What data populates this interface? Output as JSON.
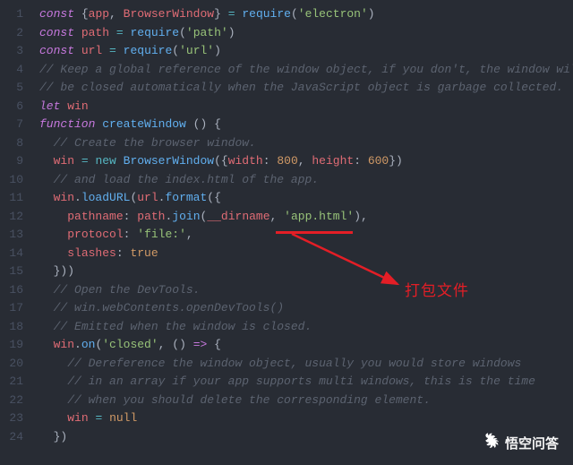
{
  "lines": [
    {
      "n": 1,
      "html": "<span class='kw'>const</span> <span class='pun'>{</span><span class='var'>app</span><span class='pun'>,</span> <span class='var'>BrowserWindow</span><span class='pun'>}</span> <span class='op'>=</span> <span class='fn'>require</span><span class='pun'>(</span><span class='str'>'electron'</span><span class='pun'>)</span>"
    },
    {
      "n": 2,
      "html": "<span class='kw'>const</span> <span class='var'>path</span> <span class='op'>=</span> <span class='fn'>require</span><span class='pun'>(</span><span class='str'>'path'</span><span class='pun'>)</span>"
    },
    {
      "n": 3,
      "html": "<span class='kw'>const</span> <span class='var'>url</span> <span class='op'>=</span> <span class='fn'>require</span><span class='pun'>(</span><span class='str'>'url'</span><span class='pun'>)</span>"
    },
    {
      "n": 4,
      "html": "<span class='com'>// Keep a global reference of the window object, if you don't, the window will</span>"
    },
    {
      "n": 5,
      "html": "<span class='com'>// be closed automatically when the JavaScript object is garbage collected.</span>"
    },
    {
      "n": 6,
      "html": "<span class='kw'>let</span> <span class='var'>win</span>"
    },
    {
      "n": 7,
      "html": "<span class='kw'>function</span> <span class='fn'>createWindow</span> <span class='pun'>() {</span>"
    },
    {
      "n": 8,
      "html": "  <span class='com'>// Create the browser window.</span>"
    },
    {
      "n": 9,
      "html": "  <span class='var'>win</span> <span class='op'>=</span> <span class='op'>new</span> <span class='fn'>BrowserWindow</span><span class='pun'>({</span><span class='var'>width</span><span class='pun'>:</span> <span class='num'>800</span><span class='pun'>,</span> <span class='var'>height</span><span class='pun'>:</span> <span class='num'>600</span><span class='pun'>})</span>"
    },
    {
      "n": 10,
      "html": "  <span class='com'>// and load the index.html of the app.</span>"
    },
    {
      "n": 11,
      "html": "  <span class='var'>win</span><span class='pun'>.</span><span class='fn'>loadURL</span><span class='pun'>(</span><span class='var'>url</span><span class='pun'>.</span><span class='fn'>format</span><span class='pun'>({</span>"
    },
    {
      "n": 12,
      "html": "    <span class='var'>pathname</span><span class='pun'>:</span> <span class='var'>path</span><span class='pun'>.</span><span class='fn'>join</span><span class='pun'>(</span><span class='var'>__dirname</span><span class='pun'>,</span> <span class='str'>'app.html'</span><span class='pun'>),</span>"
    },
    {
      "n": 13,
      "html": "    <span class='var'>protocol</span><span class='pun'>:</span> <span class='str'>'file:'</span><span class='pun'>,</span>"
    },
    {
      "n": 14,
      "html": "    <span class='var'>slashes</span><span class='pun'>:</span> <span class='const'>true</span>"
    },
    {
      "n": 15,
      "html": "  <span class='pun'>}))</span>"
    },
    {
      "n": 16,
      "html": "  <span class='com'>// Open the DevTools.</span>"
    },
    {
      "n": 17,
      "html": "  <span class='com'>// win.webContents.openDevTools()</span>"
    },
    {
      "n": 18,
      "html": "  <span class='com'>// Emitted when the window is closed.</span>"
    },
    {
      "n": 19,
      "html": "  <span class='var'>win</span><span class='pun'>.</span><span class='fn'>on</span><span class='pun'>(</span><span class='str'>'closed'</span><span class='pun'>,</span> <span class='pun'>()</span> <span class='kw2'>=></span> <span class='pun'>{</span>"
    },
    {
      "n": 20,
      "html": "    <span class='com'>// Dereference the window object, usually you would store windows</span>"
    },
    {
      "n": 21,
      "html": "    <span class='com'>// in an array if your app supports multi windows, this is the time</span>"
    },
    {
      "n": 22,
      "html": "    <span class='com'>// when you should delete the corresponding element.</span>"
    },
    {
      "n": 23,
      "html": "    <span class='var'>win</span> <span class='op'>=</span> <span class='const'>null</span>"
    },
    {
      "n": 24,
      "html": "  <span class='pun'>})</span>"
    }
  ],
  "annotation_label": "打包文件",
  "watermark_text": "悟空问答",
  "colors": {
    "bg": "#282c34",
    "accent_red": "#e41e26"
  }
}
